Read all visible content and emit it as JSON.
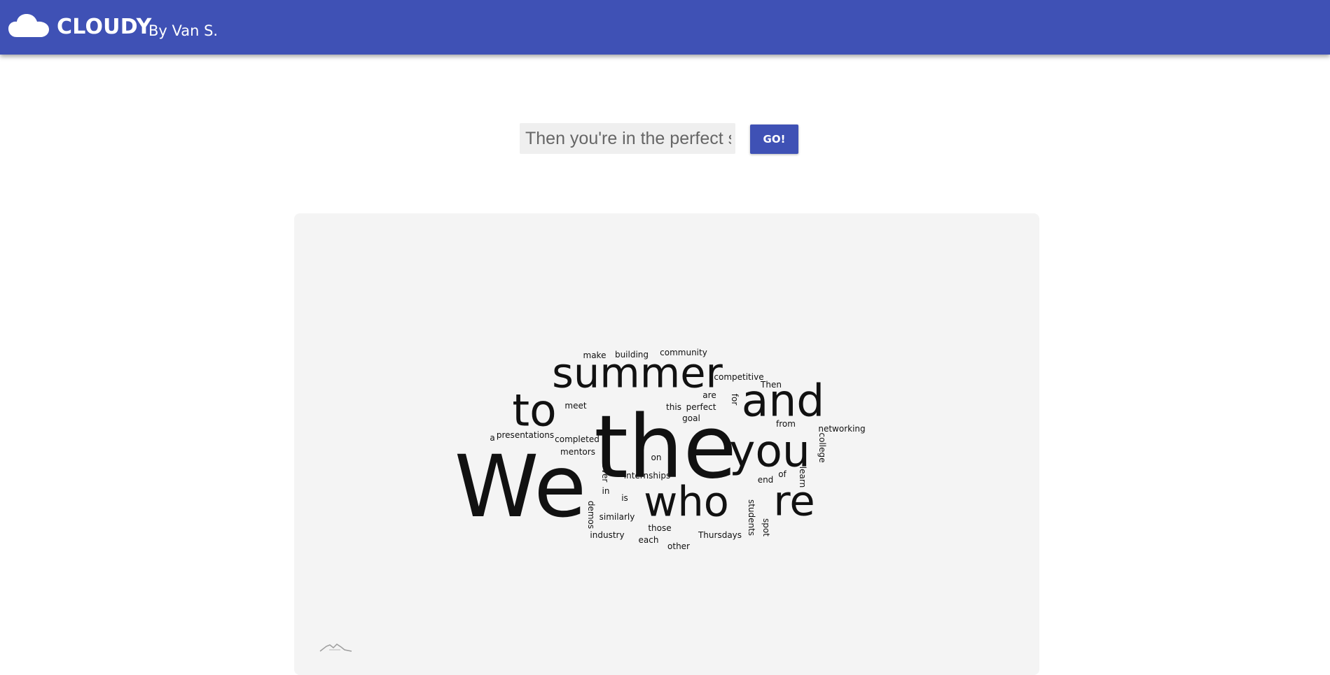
{
  "app": {
    "title": "CLOUDY",
    "byline": "By Van S.",
    "accent_color": "#3f51b5",
    "logo_icon": "cloud-icon"
  },
  "form": {
    "text_value": "Then you're in the perfect spot",
    "go_label": "GO!"
  },
  "word_cloud": {
    "words": [
      {
        "text": "We",
        "size": 122,
        "rotated": false
      },
      {
        "text": "the",
        "size": 124,
        "rotated": false
      },
      {
        "text": "summer",
        "size": 59,
        "rotated": false
      },
      {
        "text": "and",
        "size": 63,
        "rotated": false
      },
      {
        "text": "to",
        "size": 63,
        "rotated": false
      },
      {
        "text": "you",
        "size": 63,
        "rotated": false
      },
      {
        "text": "who",
        "size": 59,
        "rotated": false
      },
      {
        "text": "re",
        "size": 59,
        "rotated": false
      },
      {
        "text": "make",
        "size": 12,
        "rotated": false
      },
      {
        "text": "building",
        "size": 12,
        "rotated": false
      },
      {
        "text": "community",
        "size": 12,
        "rotated": false
      },
      {
        "text": "competitive",
        "size": 12,
        "rotated": false
      },
      {
        "text": "Then",
        "size": 12,
        "rotated": false
      },
      {
        "text": "are",
        "size": 12,
        "rotated": false
      },
      {
        "text": "for",
        "size": 12,
        "rotated": true
      },
      {
        "text": "meet",
        "size": 12,
        "rotated": false
      },
      {
        "text": "this",
        "size": 12,
        "rotated": false
      },
      {
        "text": "perfect",
        "size": 12,
        "rotated": false
      },
      {
        "text": "goal",
        "size": 12,
        "rotated": false
      },
      {
        "text": "from",
        "size": 12,
        "rotated": false
      },
      {
        "text": "networking",
        "size": 12,
        "rotated": false
      },
      {
        "text": "college",
        "size": 12,
        "rotated": true
      },
      {
        "text": "a",
        "size": 12,
        "rotated": false
      },
      {
        "text": "presentations",
        "size": 12,
        "rotated": false
      },
      {
        "text": "completed",
        "size": 12,
        "rotated": false
      },
      {
        "text": "mentors",
        "size": 12,
        "rotated": false
      },
      {
        "text": "on",
        "size": 12,
        "rotated": false
      },
      {
        "text": "over",
        "size": 12,
        "rotated": true
      },
      {
        "text": "internships",
        "size": 12,
        "rotated": false
      },
      {
        "text": "of",
        "size": 12,
        "rotated": false
      },
      {
        "text": "learn",
        "size": 12,
        "rotated": true
      },
      {
        "text": "end",
        "size": 12,
        "rotated": false
      },
      {
        "text": "in",
        "size": 12,
        "rotated": false
      },
      {
        "text": "is",
        "size": 12,
        "rotated": false
      },
      {
        "text": "demos",
        "size": 12,
        "rotated": true
      },
      {
        "text": "similarly",
        "size": 12,
        "rotated": false
      },
      {
        "text": "students",
        "size": 12,
        "rotated": true
      },
      {
        "text": "spot",
        "size": 12,
        "rotated": true
      },
      {
        "text": "those",
        "size": 12,
        "rotated": false
      },
      {
        "text": "industry",
        "size": 12,
        "rotated": false
      },
      {
        "text": "Thursdays",
        "size": 12,
        "rotated": false
      },
      {
        "text": "each",
        "size": 12,
        "rotated": false
      },
      {
        "text": "other",
        "size": 12,
        "rotated": false
      }
    ]
  }
}
